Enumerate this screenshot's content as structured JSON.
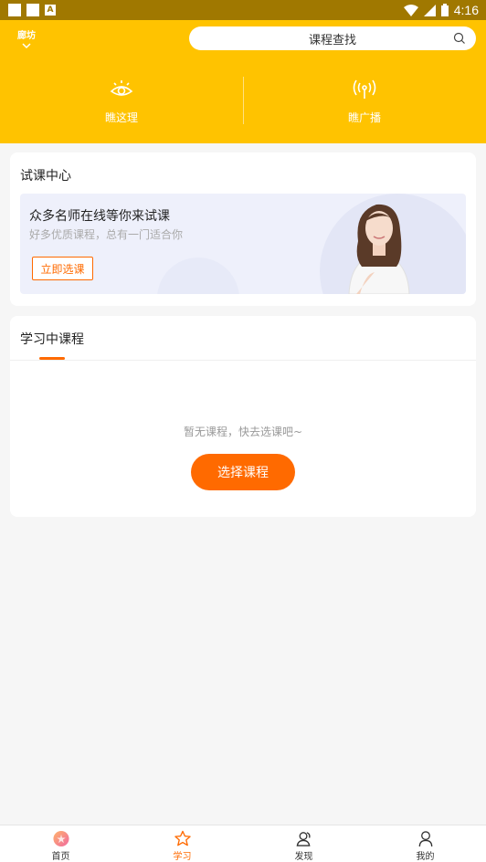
{
  "status_bar": {
    "time": "4:16"
  },
  "header": {
    "city": "廊坊",
    "search_placeholder": "课程查找",
    "nav": [
      {
        "label": "瞧这理",
        "icon": "eye-icon"
      },
      {
        "label": "瞧广播",
        "icon": "broadcast-icon"
      }
    ]
  },
  "trial": {
    "title": "试课中心",
    "banner_heading": "众多名师在线等你来试课",
    "banner_sub": "好多优质课程，总有一门适合你",
    "banner_button": "立即选课"
  },
  "learning": {
    "tab": "学习中课程",
    "empty": "暂无课程，快去选课吧~",
    "button": "选择课程"
  },
  "bottom_nav": [
    {
      "label": "首页",
      "icon": "home-icon"
    },
    {
      "label": "学习",
      "icon": "star-icon",
      "active": true
    },
    {
      "label": "发现",
      "icon": "discover-icon"
    },
    {
      "label": "我的",
      "icon": "user-icon"
    }
  ],
  "colors": {
    "primary_yellow": "#ffc300",
    "accent_orange": "#ff6a00"
  }
}
